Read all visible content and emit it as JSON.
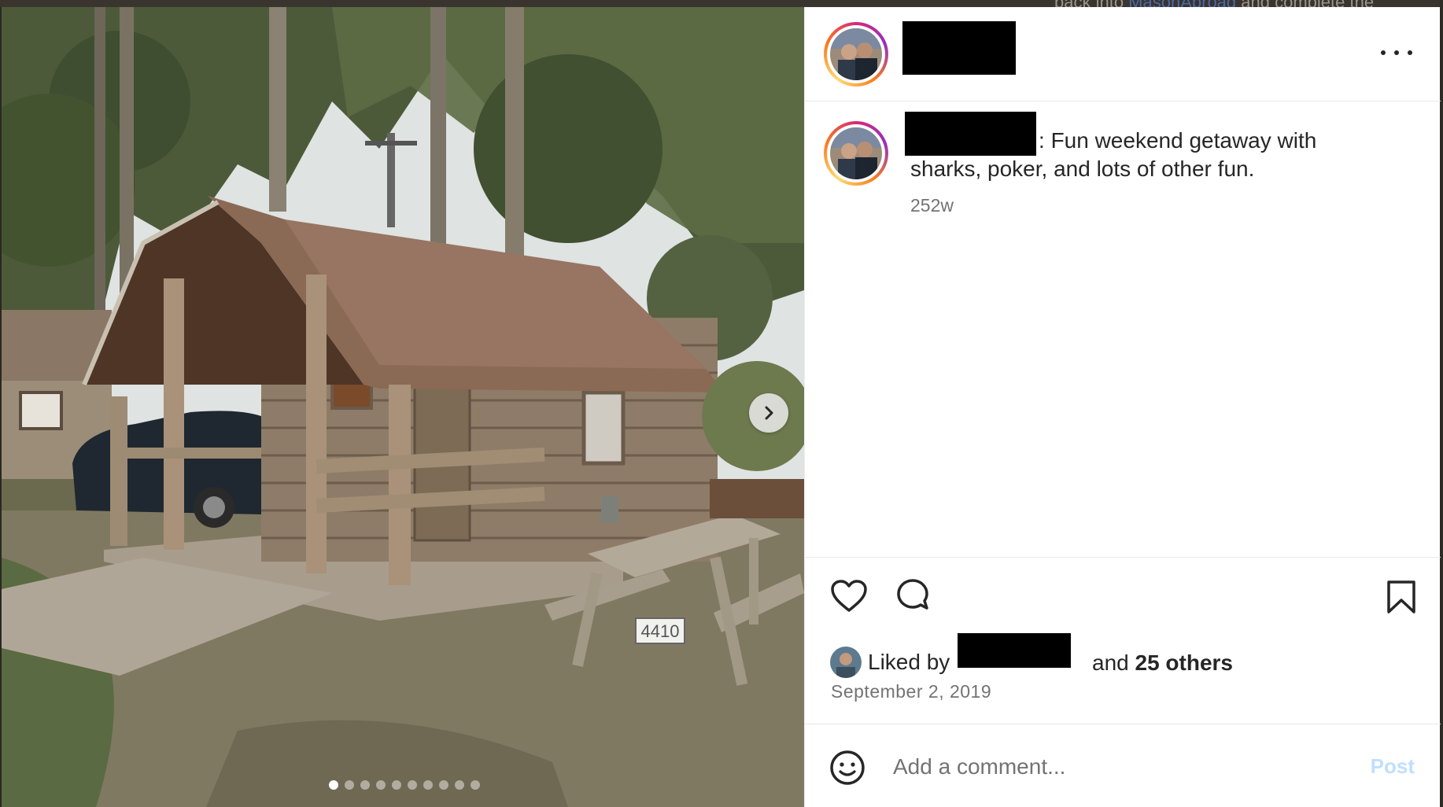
{
  "backdrop": {
    "text_before": "back into ",
    "link_text": "MasonAbroad",
    "text_after": " and complete the"
  },
  "post": {
    "image_alt": "Log cabin with a covered porch and a picnic table at a campground",
    "table_sign": "4410",
    "carousel": {
      "total_slides": 10,
      "active_index": 0
    },
    "next_icon": "chevron-right-icon",
    "author_redacted": true,
    "more_icon": "more-horizontal-icon",
    "caption": {
      "separator": ":",
      "text_line1": "Fun weekend getaway with",
      "text_line2": "sharks, poker, and lots of other fun."
    },
    "time_ago": "252w",
    "actions": {
      "like_icon": "heart-icon",
      "comment_icon": "comment-icon",
      "save_icon": "bookmark-icon"
    },
    "likes": {
      "prefix": "Liked by",
      "middle": "and",
      "others": "25 others"
    },
    "date": "September 2, 2019",
    "comment": {
      "emoji_icon": "smiley-icon",
      "placeholder": "Add a comment...",
      "post_label": "Post"
    }
  },
  "colors": {
    "story_ring": [
      "#d62976",
      "#962fbf",
      "#fa7e1e",
      "#feda75"
    ],
    "post_button_disabled": "#c0dffd",
    "secondary_text": "#737373"
  }
}
